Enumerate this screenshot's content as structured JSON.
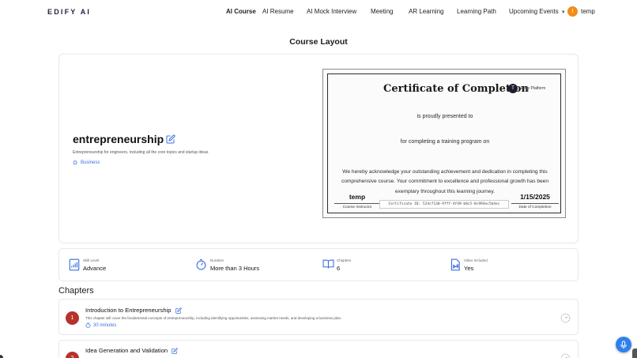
{
  "brand": {
    "logo": "EDIFY AI"
  },
  "nav": {
    "items": [
      "AI Course",
      "AI Resume",
      "AI Mock Interview",
      "Meeting",
      "AR Learning",
      "Learning Path",
      "Upcoming Events"
    ],
    "active": "AI Course"
  },
  "user": {
    "initial": "t",
    "name": "temp",
    "avatar_color": "#f28c1a"
  },
  "page_title": "Course Layout",
  "course": {
    "name": "entrepreneurship",
    "description": "Entrepreneurship for engineers, including all the core topics and startup ideas",
    "category": "Business"
  },
  "certificate": {
    "title": "Certificate of Completion",
    "logo_initial": "T",
    "org": "Edify Platform",
    "presented": "is proudly presented to",
    "for_text": "for completing a training program on",
    "body": "We hereby acknowledge your outstanding achievement and dedication in completing this comprehensive course. Your commitment to excellence and professional growth has been exemplary throughout this learning journey.",
    "signer_name": "temp",
    "signer_role": "Course Instructor",
    "cert_id": "Certificate ID: 524cf130-9fff-4fd9-b8c5-0c994ec5b4ec",
    "date": "1/15/2025",
    "date_label": "Date of Completion"
  },
  "stats": [
    {
      "icon": "skill-level-icon",
      "label": "Skill Level",
      "value": "Advance"
    },
    {
      "icon": "stopwatch-icon",
      "label": "Duration",
      "value": "More than 3 Hours"
    },
    {
      "icon": "book-icon",
      "label": "Chapters",
      "value": "6"
    },
    {
      "icon": "video-icon",
      "label": "Video Included",
      "value": "Yes"
    }
  ],
  "chapters_title": "Chapters",
  "chapters": [
    {
      "num": "1",
      "title": "Introduction to Entrepreneurship",
      "desc": "This chapter will cover the fundamental concepts of entrepreneurship, including identifying opportunities, assessing market needs, and developing a business plan.",
      "time": "30 minutes"
    },
    {
      "num": "2",
      "title": "Idea Generation and Validation",
      "desc": "",
      "time": ""
    }
  ],
  "colors": {
    "accent": "#3b6fe0",
    "chapter_badge": "#b7322c",
    "mic": "#2f80ed"
  }
}
